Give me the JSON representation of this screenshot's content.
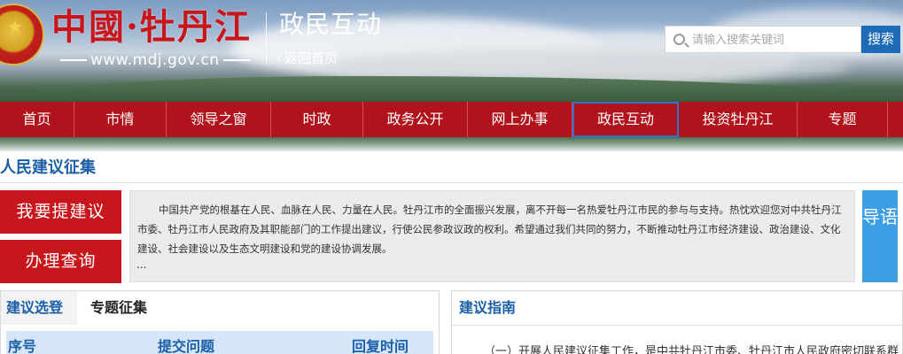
{
  "header": {
    "logo_text": "中國·牡丹江",
    "site_url": "www.mdj.gov.cn",
    "section_title": "政民互动",
    "back_home": "返回首页",
    "search": {
      "placeholder": "请输入搜索关键词",
      "button_label": "搜索"
    }
  },
  "nav": {
    "items": [
      {
        "label": "首页"
      },
      {
        "label": "市情"
      },
      {
        "label": "领导之窗"
      },
      {
        "label": "时政"
      },
      {
        "label": "政务公开"
      },
      {
        "label": "网上办事"
      },
      {
        "label": "政民互动",
        "active": true
      },
      {
        "label": "投资牡丹江"
      },
      {
        "label": "专题"
      }
    ]
  },
  "page": {
    "heading": "人民建议征集",
    "actions": {
      "submit_label": "我要提建议",
      "query_label": "办理查询"
    },
    "intro": "中国共产党的根基在人民、血脉在人民、力量在人民。牡丹江市的全面振兴发展，离不开每一名热爱牡丹江市民的参与与支持。热忱欢迎您对中共牡丹江市委、牡丹江市人民政府及其职能部门的工作提出建议，行使公民参政议政的权利。希望通过我们共同的努力，不断推动牡丹江市经济建设、政治建设、文化建设、社会建设以及生态文明建设和党的建设协调发展。",
    "intro_more": "...",
    "guide_button": "导语"
  },
  "left_panel": {
    "tabs": [
      "建议选登",
      "专题征集"
    ],
    "columns": [
      "序号",
      "提交问题",
      "回复时间"
    ]
  },
  "right_panel": {
    "title": "建议指南",
    "text": "（一）开展人民建议征集工作，是中共牡丹江市委、牡丹江市人民政府密切联系群"
  },
  "colors": {
    "brand_red": "#b1131c",
    "button_red": "#c8161d",
    "link_blue": "#1b5fa8",
    "search_blue": "#1e6bb8",
    "guide_blue": "#3e9ee3"
  }
}
